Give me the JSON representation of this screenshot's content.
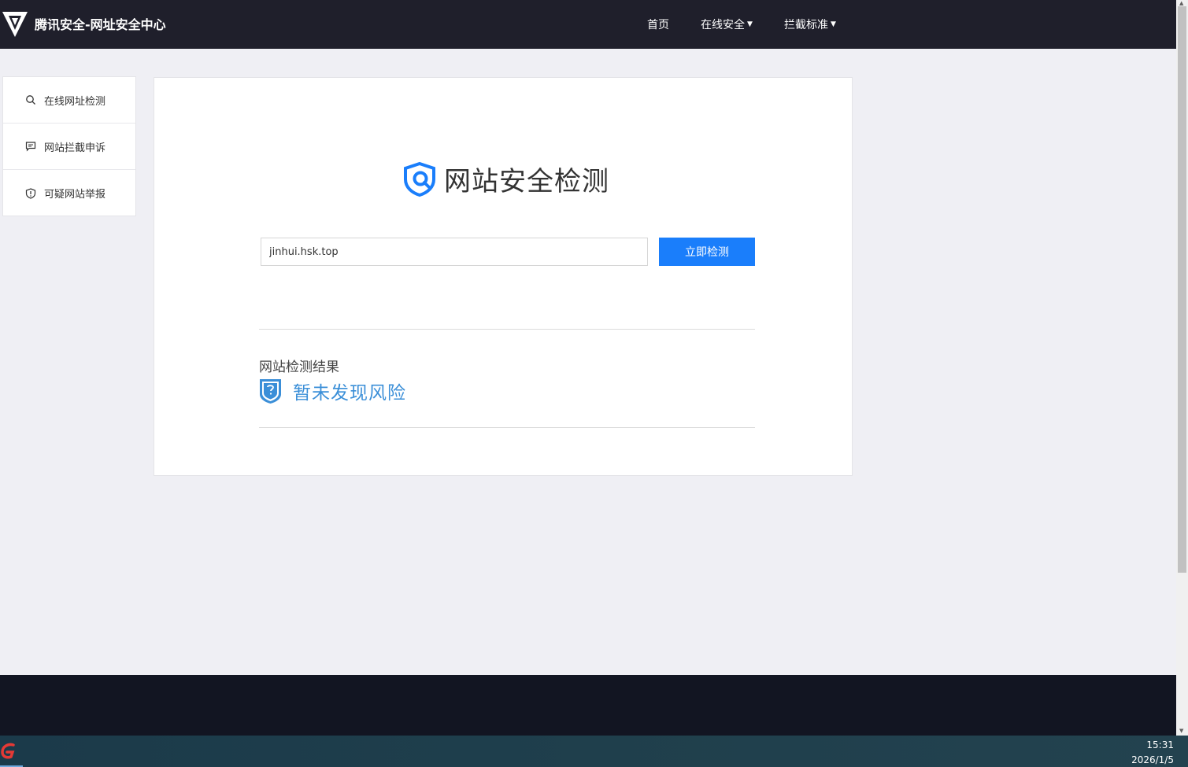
{
  "header": {
    "brand_title": "腾讯安全-网址安全中心",
    "nav": {
      "home": "首页",
      "online_security": "在线安全",
      "block_standard": "拦截标准"
    }
  },
  "sidebar": {
    "items": [
      {
        "label": "在线网址检测",
        "icon": "search-icon"
      },
      {
        "label": "网站拦截申诉",
        "icon": "chat-icon"
      },
      {
        "label": "可疑网站举报",
        "icon": "shield-alert-icon"
      }
    ]
  },
  "main": {
    "title": "网站安全检测",
    "url_input_value": "jinhui.hsk.top",
    "check_button": "立即检测",
    "result_label": "网站检测结果",
    "result_text": "暂未发现风险"
  },
  "taskbar": {
    "time": "15:31",
    "date": "2026/1/5"
  },
  "colors": {
    "accent": "#1a7efb",
    "header_bg": "#1f1f2b",
    "result_blue": "#3b8fd8"
  }
}
